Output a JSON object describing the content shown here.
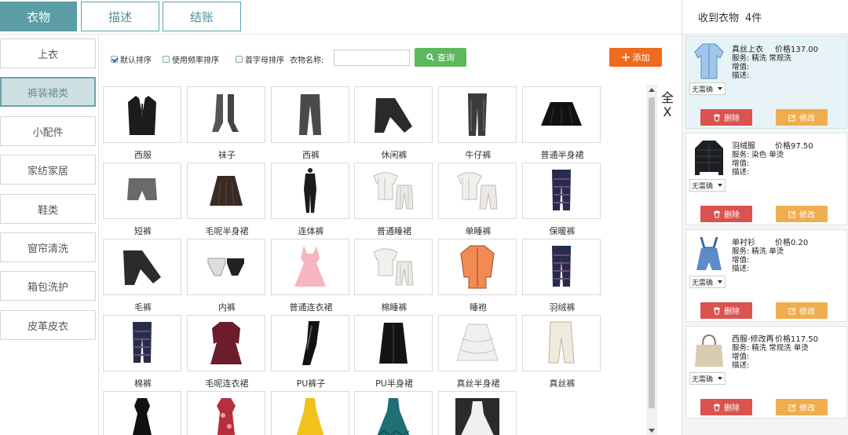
{
  "tabs": [
    "衣物",
    "描述",
    "结账"
  ],
  "categories": [
    "上衣",
    "裤装裙类",
    "小配件",
    "家纺家居",
    "鞋类",
    "窗帘清洗",
    "箱包洗护",
    "皮革皮衣"
  ],
  "filters": {
    "default_sort": "默认排序",
    "freq_sort": "使用频率排序",
    "initial_sort": "首字母排序",
    "name_label": "衣物名称:",
    "name_value": "",
    "search_label": "查询",
    "add_label": "添加"
  },
  "select_all": "全\nX",
  "items": [
    {
      "label": "西服",
      "icon": "suit-jacket-icon"
    },
    {
      "label": "袜子",
      "icon": "socks-icon"
    },
    {
      "label": "西裤",
      "icon": "dress-pants-icon"
    },
    {
      "label": "休闲裤",
      "icon": "casual-pants-icon"
    },
    {
      "label": "牛仔裤",
      "icon": "jeans-icon"
    },
    {
      "label": "普通半身裙",
      "icon": "skirt-icon"
    },
    {
      "label": "短裤",
      "icon": "shorts-icon"
    },
    {
      "label": "毛呢半身裙",
      "icon": "wool-skirt-icon"
    },
    {
      "label": "连体裤",
      "icon": "jumpsuit-icon"
    },
    {
      "label": "普通睡裙",
      "icon": "pajama-set-icon"
    },
    {
      "label": "单睡裤",
      "icon": "pajama-pants-icon"
    },
    {
      "label": "保暖裤",
      "icon": "thermal-pants-icon"
    },
    {
      "label": "毛裤",
      "icon": "wool-pants-icon"
    },
    {
      "label": "内裤",
      "icon": "underwear-icon"
    },
    {
      "label": "普通连衣裙",
      "icon": "dress-icon"
    },
    {
      "label": "棉睡裤",
      "icon": "cotton-pajama-icon"
    },
    {
      "label": "睡袍",
      "icon": "robe-icon"
    },
    {
      "label": "羽绒裤",
      "icon": "down-pants-icon"
    },
    {
      "label": "棉裤",
      "icon": "cotton-pants-icon"
    },
    {
      "label": "毛呢连衣裙",
      "icon": "wool-dress-icon"
    },
    {
      "label": "PU裤子",
      "icon": "leather-pants-icon"
    },
    {
      "label": "PU半身裙",
      "icon": "leather-skirt-icon"
    },
    {
      "label": "真丝半身裙",
      "icon": "silk-skirt-icon"
    },
    {
      "label": "真丝裤",
      "icon": "silk-pants-icon"
    },
    {
      "label": "",
      "icon": "black-dress-icon"
    },
    {
      "label": "",
      "icon": "qipao-icon"
    },
    {
      "label": "",
      "icon": "gown-yellow-icon"
    },
    {
      "label": "",
      "icon": "gown-teal-icon"
    },
    {
      "label": "",
      "icon": "wedding-dress-icon"
    }
  ],
  "received": {
    "title": "收到衣物",
    "count": "4件",
    "service_label": "服务:",
    "surcharge_label": "增值:",
    "desc_label": "描述:",
    "dropdown_value": "无需确",
    "delete_label": "删除",
    "edit_label": "修改",
    "list": [
      {
        "name": "真丝上衣",
        "price": "价格137.00",
        "service": "精洗 常规洗",
        "icon": "shirt-icon",
        "selected": true
      },
      {
        "name": "羽绒服",
        "price": "价格97.50",
        "service": "染色 单烫",
        "icon": "down-jacket-icon",
        "selected": false
      },
      {
        "name": "单衬衫",
        "price": "价格0.20",
        "service": "精洗 单烫",
        "icon": "overalls-icon",
        "selected": false
      },
      {
        "name": "西服-修改再",
        "price": "价格117.50",
        "service": "精洗 常规洗 单烫",
        "icon": "tote-bag-icon",
        "selected": false
      }
    ]
  },
  "colors": {
    "accent": "#5b9ca5",
    "search": "#5cb85c",
    "add": "#ee6a1f",
    "delete": "#d9534f",
    "edit": "#f0ad4e"
  }
}
